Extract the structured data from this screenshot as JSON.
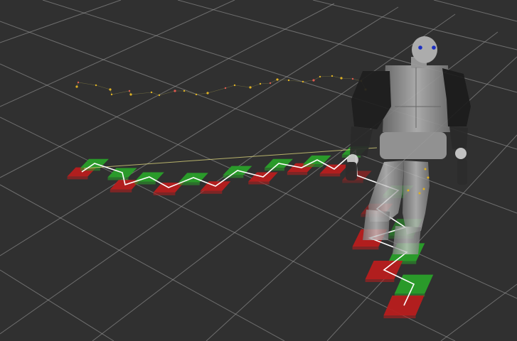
{
  "viewport": {
    "background_color": "#303030",
    "grid_color": "#a0a0a0",
    "left_foot_color": "#2aa02a",
    "right_foot_color": "#b81e1e",
    "path_color": "#ffffff",
    "trajectory_color": "#d4c95a",
    "com_dot_color": "#e0b020"
  },
  "robot": {
    "name": "",
    "body_color": "#8a8a8a",
    "arm_color": "#1c1c1c",
    "eye_color": "#1b2fcf"
  },
  "footsteps": {
    "count": 22,
    "description_icon": "footstep-plan-icon"
  }
}
